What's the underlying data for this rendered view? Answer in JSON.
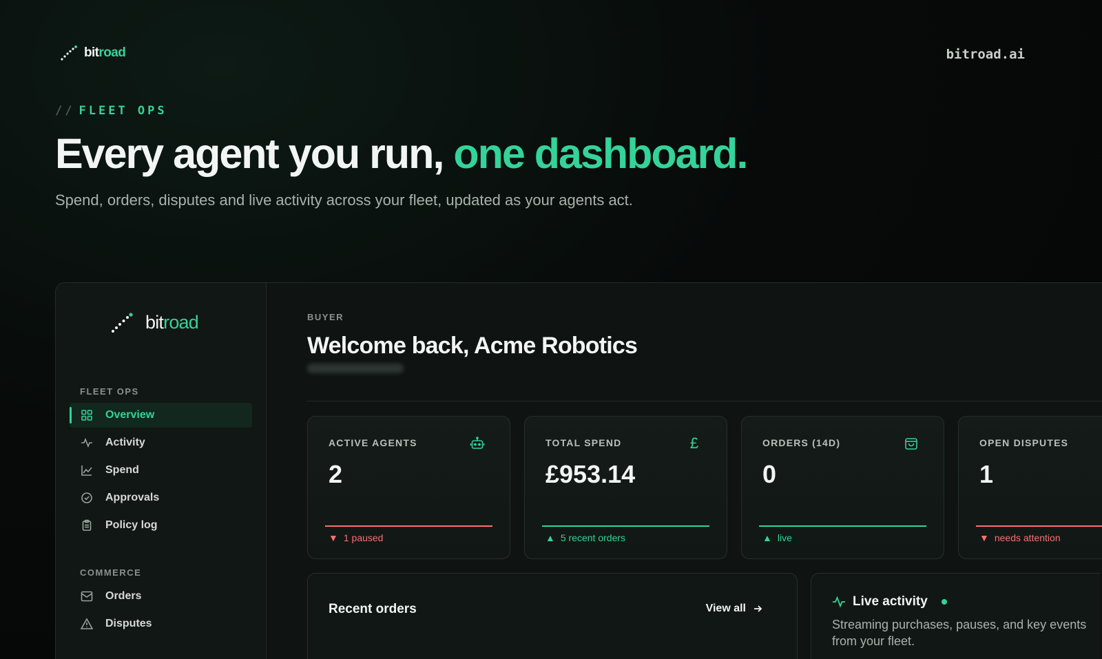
{
  "top": {
    "brand_a": "bit",
    "brand_b": "road",
    "site_link": "bitroad.ai"
  },
  "hero": {
    "kicker_slash": "//",
    "kicker": "FLEET OPS",
    "title_white": "Every agent you run, ",
    "title_green": "one dashboard.",
    "subtitle": "Spend, orders, disputes and live activity across your fleet, updated as your agents act."
  },
  "sidebar": {
    "brand_a": "bit",
    "brand_b": "road",
    "section_fleet": "FLEET OPS",
    "fleet_items": [
      {
        "label": "Overview",
        "icon": "grid-icon"
      },
      {
        "label": "Activity",
        "icon": "pulse-icon"
      },
      {
        "label": "Spend",
        "icon": "chart-icon"
      },
      {
        "label": "Approvals",
        "icon": "check-circle-icon"
      },
      {
        "label": "Policy log",
        "icon": "clipboard-icon"
      }
    ],
    "section_commerce": "COMMERCE",
    "commerce_items": [
      {
        "label": "Orders",
        "icon": "inbox-icon"
      },
      {
        "label": "Disputes",
        "icon": "warning-icon"
      }
    ]
  },
  "main": {
    "role": "BUYER",
    "welcome": "Welcome back, Acme Robotics"
  },
  "cards": [
    {
      "label": "ACTIVE AGENTS",
      "value": "2",
      "foot": "1 paused",
      "arrow": "▼",
      "icon": "robot-icon"
    },
    {
      "label": "TOTAL SPEND",
      "value": "£953.14",
      "foot": "5 recent orders",
      "arrow": "▲",
      "icon": "pound-icon",
      "icon_glyph": "£"
    },
    {
      "label": "ORDERS (14D)",
      "value": "0",
      "foot": "live",
      "arrow": "▲",
      "icon": "bag-icon"
    },
    {
      "label": "OPEN DISPUTES",
      "value": "1",
      "foot": "needs attention",
      "arrow": "▼",
      "icon": "alert-icon"
    }
  ],
  "panels": {
    "recent_orders": "Recent orders",
    "view_all": "View all",
    "live_activity": "Live activity",
    "live_desc": "Streaming purchases, pauses, and key events from your fleet."
  },
  "colors": {
    "accent": "#34d399",
    "danger": "#f87171",
    "background": "#070a09"
  }
}
